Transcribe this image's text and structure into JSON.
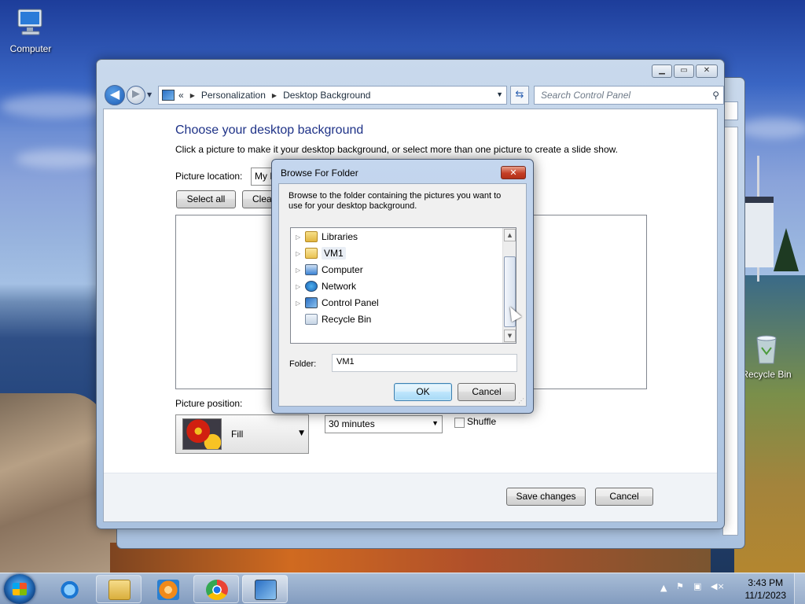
{
  "desktop": {
    "computer_label": "Computer",
    "recycle_label": "Recycle Bin"
  },
  "window": {
    "address": {
      "chevron": "«",
      "crumb1": "Personalization",
      "crumb2": "Desktop Background"
    },
    "search_placeholder": "Search Control Panel",
    "title": "Choose your desktop background",
    "description": "Click a picture to make it your desktop background, or select more than one picture to create a slide show.",
    "picture_location_label": "Picture location:",
    "picture_location_value": "My Pictures",
    "select_all": "Select all",
    "clear_all": "Clear all",
    "picture_position_label": "Picture position:",
    "picture_position_value": "Fill",
    "interval_value": "30 minutes",
    "shuffle_label": "Shuffle",
    "save_changes": "Save changes",
    "cancel": "Cancel"
  },
  "dialog": {
    "title": "Browse For Folder",
    "message": "Browse to the folder containing the pictures you want to use for your desktop background.",
    "tree": [
      {
        "label": "Libraries",
        "icon": "libraries-icon"
      },
      {
        "label": "VM1",
        "icon": "user-folder-icon"
      },
      {
        "label": "Computer",
        "icon": "computer-icon"
      },
      {
        "label": "Network",
        "icon": "network-icon"
      },
      {
        "label": "Control Panel",
        "icon": "control-panel-icon"
      },
      {
        "label": "Recycle Bin",
        "icon": "recycle-bin-icon"
      }
    ],
    "folder_label": "Folder:",
    "folder_value": "VM1",
    "ok": "OK",
    "cancel": "Cancel"
  },
  "taskbar": {
    "time": "3:43 PM",
    "date": "11/1/2023"
  },
  "colors": {
    "accent_title": "#1e3287",
    "taskbar": "#8ca5c8",
    "ok_button": "#bee6fd"
  }
}
